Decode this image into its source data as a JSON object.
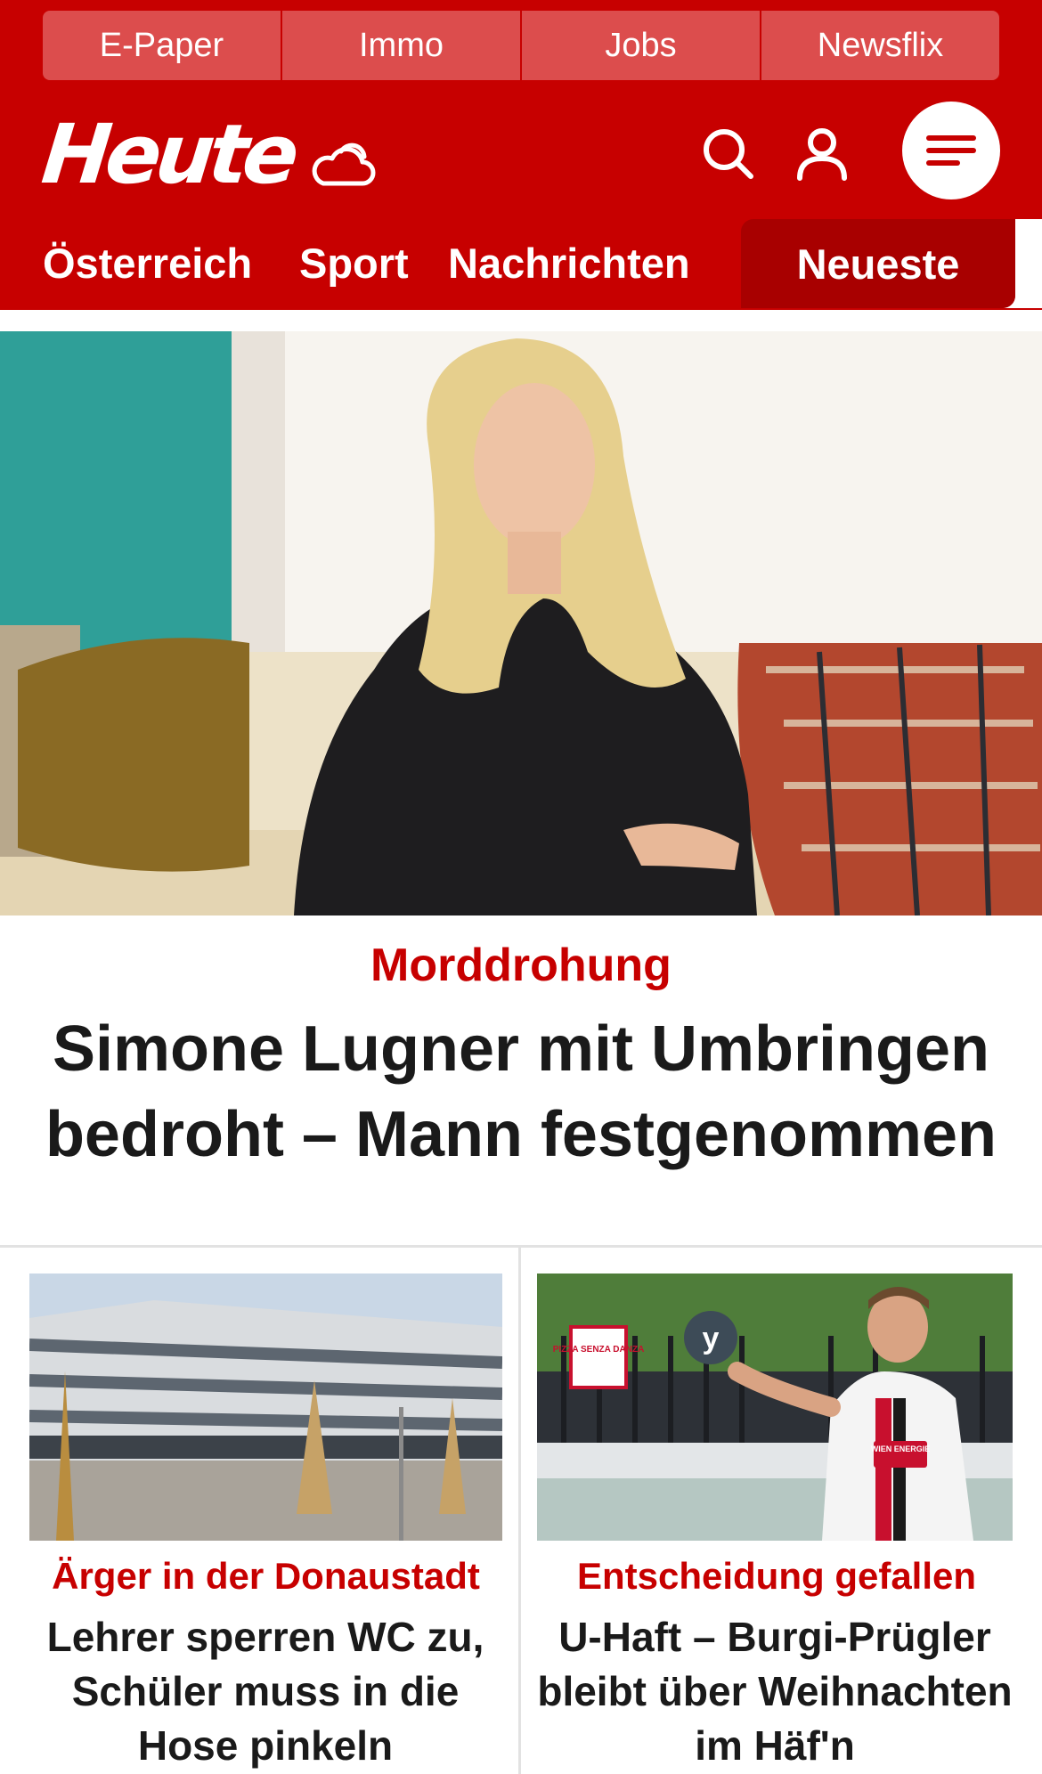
{
  "topbar": {
    "items": [
      {
        "label": "E-Paper"
      },
      {
        "label": "Immo"
      },
      {
        "label": "Jobs"
      },
      {
        "label": "Newsflix"
      }
    ]
  },
  "brand": {
    "logo_text": "Heute",
    "weather_icon": "cloud-sun-icon"
  },
  "header_icons": [
    "search-icon",
    "user-icon",
    "menu-icon"
  ],
  "nav": {
    "items": [
      {
        "label": "Österreich"
      },
      {
        "label": "Sport"
      },
      {
        "label": "Nachrichten"
      }
    ],
    "highlight": {
      "label": "Neueste"
    }
  },
  "hero": {
    "kicker": "Morddrohung",
    "title": "Simone Lugner mit Umbringen bedroht – Mann festgenommen"
  },
  "teasers": [
    {
      "kicker": "Ärger in der Donaustadt",
      "title": "Lehrer sperren WC zu, Schüler muss in die Hose pinkeln"
    },
    {
      "kicker": "Entscheidung gefallen",
      "title": "U-Haft – Burgi-Prügler bleibt über Weihnachten im Häf'n",
      "image_texts": [
        "PIZZA SENZA DANZA",
        "WIEN ENERGIE"
      ]
    }
  ],
  "colors": {
    "brand_red": "#c70000",
    "topbar_red": "#dc4d4d",
    "highlight_red": "#a80000",
    "text_dark": "#1a1a1a"
  }
}
